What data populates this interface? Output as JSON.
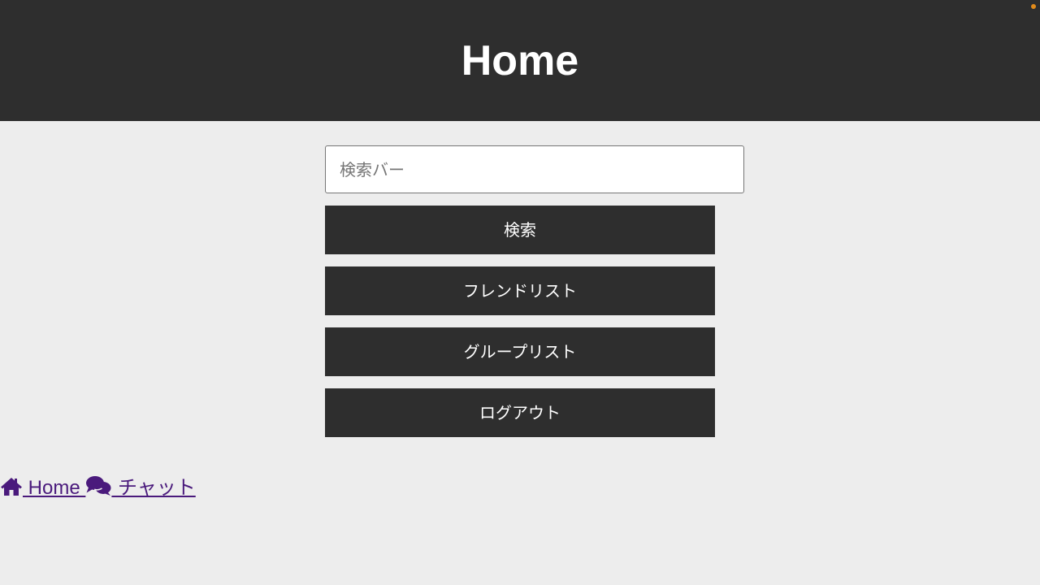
{
  "header": {
    "title": "Home"
  },
  "search": {
    "placeholder": "検索バー",
    "value": ""
  },
  "buttons": {
    "search": "検索",
    "friend_list": "フレンドリスト",
    "group_list": "グループリスト",
    "logout": "ログアウト"
  },
  "bottom_nav": {
    "items": [
      {
        "label": " Home ",
        "icon": "home-icon"
      },
      {
        "label": " チャット",
        "icon": "chat-icon"
      }
    ]
  },
  "colors": {
    "header_bg": "#2e2e2e",
    "page_bg": "#ededed",
    "button_bg": "#2e2e2e",
    "link": "#4a1a7c",
    "corner_dot": "#e08a1a"
  }
}
